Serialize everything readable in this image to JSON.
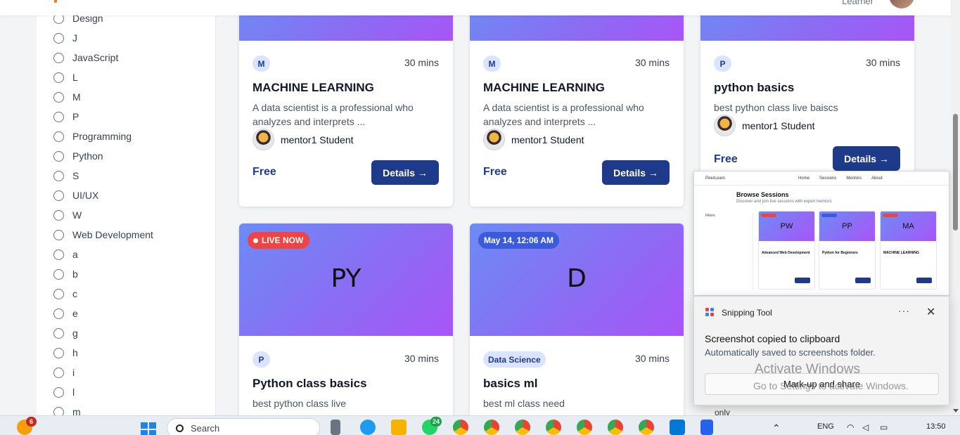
{
  "header": {
    "role_label": "Learner"
  },
  "sidebar": {
    "categories": [
      "Design",
      "J",
      "JavaScript",
      "L",
      "M",
      "P",
      "Programming",
      "Python",
      "S",
      "UI/UX",
      "W",
      "Web Development",
      "a",
      "b",
      "c",
      "e",
      "g",
      "h",
      "i",
      "l",
      "m"
    ]
  },
  "cards": [
    {
      "category": "M",
      "duration": "30 mins",
      "title": "MACHINE LEARNING",
      "description": "A data scientist is a professional who analyzes and interprets ...",
      "mentor": "mentor1 Student",
      "price": "Free",
      "button": "Details →"
    },
    {
      "category": "M",
      "duration": "30 mins",
      "title": "MACHINE LEARNING",
      "description": "A data scientist is a professional who analyzes and interprets ...",
      "mentor": "mentor1 Student",
      "price": "Free",
      "button": "Details →"
    },
    {
      "category": "P",
      "duration": "30 mins",
      "title": "python basics",
      "description": "best python class live baiscs",
      "mentor": "mentor1 Student",
      "price": "Free",
      "button": "Details →"
    },
    {
      "badge": "LIVE NOW",
      "initials": "PY",
      "category": "P",
      "duration": "30 mins",
      "title": "Python class basics",
      "description": "best python class live"
    },
    {
      "badge": "May 14, 12:06 AM",
      "initials": "D",
      "category": "Data Science",
      "duration": "30 mins",
      "title": "basics ml",
      "description": "best ml class need"
    }
  ],
  "snip_preview": {
    "nav": [
      "PeerLearn",
      "Home",
      "Sessions",
      "Mentors",
      "About"
    ],
    "title": "Browse Sessions",
    "subtitle": "Discover and join live sessions with expert mentors",
    "filter_label": "Filters",
    "cards": [
      {
        "initials": "PW",
        "title": "Advanced Web Development"
      },
      {
        "initials": "PP",
        "title": "Python for Beginners"
      },
      {
        "initials": "MA",
        "title": "MACHINE LEARNING"
      }
    ]
  },
  "snipping_tool": {
    "app_name": "Snipping Tool",
    "more": "···",
    "close": "✕",
    "message": "Screenshot copied to clipboard",
    "sub_message": "Automatically saved to screenshots folder.",
    "button": "Mark-up and share"
  },
  "watermark": {
    "line1": "Activate Windows",
    "line2": "Go to Settings to activate Windows."
  },
  "peek_text": "only",
  "taskbar": {
    "search_placeholder": "Search",
    "notification_badge": "6",
    "whatsapp_badge": "24",
    "language": "ENG",
    "time": "13:50"
  }
}
